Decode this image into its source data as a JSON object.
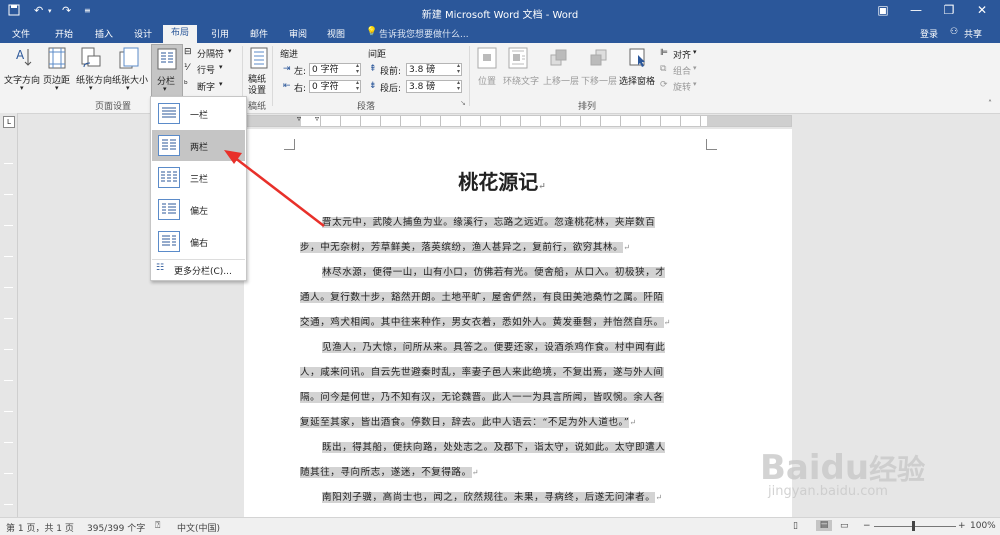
{
  "window": {
    "title": "新建 Microsoft Word 文档 - Word",
    "colors": {
      "accent": "#2b579a",
      "arrow": "#e8302a"
    }
  },
  "tabs": [
    {
      "label": "文件"
    },
    {
      "label": "开始"
    },
    {
      "label": "插入"
    },
    {
      "label": "设计"
    },
    {
      "label": "布局"
    },
    {
      "label": "引用"
    },
    {
      "label": "邮件"
    },
    {
      "label": "审阅"
    },
    {
      "label": "视图"
    }
  ],
  "tell_me": "告诉我您想要做什么...",
  "account": {
    "login": "登录",
    "share": "共享"
  },
  "ribbon": {
    "page_setup": {
      "text_direction": "文字方向",
      "margins": "页边距",
      "orientation": "纸张方向",
      "size": "纸张大小",
      "columns": "分栏",
      "breaks": "分隔符",
      "line_numbers": "行号",
      "hyphenation": "断字",
      "group_label": "页面设置"
    },
    "draft": {
      "label1": "稿纸",
      "label2": "设置",
      "group_label": "稿纸"
    },
    "paragraph": {
      "indent_label": "缩进",
      "spacing_label": "间距",
      "left_label": "左:",
      "right_label": "右:",
      "left_value": "0 字符",
      "right_value": "0 字符",
      "before_label": "段前:",
      "after_label": "段后:",
      "before_value": "3.8 磅",
      "after_value": "3.8 磅",
      "group_label": "段落"
    },
    "arrange": {
      "position": "位置",
      "wrap_text": "环绕文字",
      "bring_forward": "上移一层",
      "send_backward": "下移一层",
      "selection_pane": "选择窗格",
      "align": "对齐",
      "group": "组合",
      "rotate": "旋转",
      "group_label": "排列"
    }
  },
  "columns_menu": {
    "items": [
      {
        "label": "一栏"
      },
      {
        "label": "两栏"
      },
      {
        "label": "三栏"
      },
      {
        "label": "偏左"
      },
      {
        "label": "偏右"
      }
    ],
    "more": "更多分栏(C)..."
  },
  "document": {
    "title": "桃花源记",
    "paragraphs": [
      [
        "晋太元中，武陵人捕鱼为业。缘溪行，忘路之远近。忽逢桃花林，夹岸数百",
        "步，中无杂树，芳草鲜美，落英缤纷，渔人甚异之，复前行，欲穷其林。"
      ],
      [
        "林尽水源，便得一山，山有小口，仿佛若有光。便舍船，从口入。初极狭，才",
        "通人。复行数十步，豁然开朗。土地平旷，屋舍俨然，有良田美池桑竹之属。阡陌",
        "交通，鸡犬相闻。其中往来种作，男女衣着，悉如外人。黄发垂髫，并怡然自乐。"
      ],
      [
        "见渔人，乃大惊，问所从来。具答之。便要还家，设酒杀鸡作食。村中闻有此",
        "人，咸来问讯。自云先世避秦时乱，率妻子邑人来此绝境，不复出焉，遂与外人间",
        "隔。问今是何世，乃不知有汉，无论魏晋。此人一一为具言所闻，皆叹惋。余人各",
        "复延至其家，皆出酒食。停数日，辞去。此中人语云：“不足为外人道也。”"
      ],
      [
        "既出，得其船，便扶向路，处处志之。及郡下，诣太守，说如此。太守即遣人",
        "随其往，寻向所志，遂迷，不复得路。"
      ],
      [
        "南阳刘子骥，高尚士也，闻之，欣然规往。未果，寻病终，后遂无问津者。"
      ]
    ]
  },
  "status": {
    "page": "第 1 页，共 1 页",
    "words": "395/399 个字",
    "language": "中文(中国)",
    "zoom": "100%"
  },
  "watermark": {
    "brand": "Baidu",
    "suffix": "经验",
    "url": "jingyan.baidu.com"
  }
}
